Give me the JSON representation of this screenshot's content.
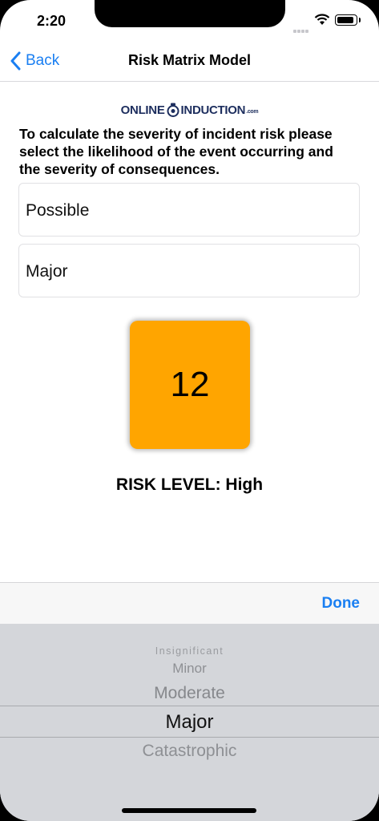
{
  "status": {
    "time": "2:20"
  },
  "nav": {
    "back_label": "Back",
    "title": "Risk Matrix Model"
  },
  "logo": {
    "left": "ONLINE",
    "right": "INDUCTION",
    "suffix": ".com"
  },
  "intro": "To calculate the severity of incident risk please select the likelihood of the event occurring and the severity of consequences.",
  "fields": {
    "likelihood": "Possible",
    "consequence": "Major"
  },
  "result": {
    "score": "12",
    "risk_level_text": "RISK LEVEL: High",
    "color": "#ffa500"
  },
  "picker": {
    "done_label": "Done",
    "options": [
      "Insignificant",
      "Minor",
      "Moderate",
      "Major",
      "Catastrophic"
    ],
    "selected": "Major"
  },
  "colors": {
    "accent": "#1a7ff2",
    "logo": "#1d2e5e"
  }
}
